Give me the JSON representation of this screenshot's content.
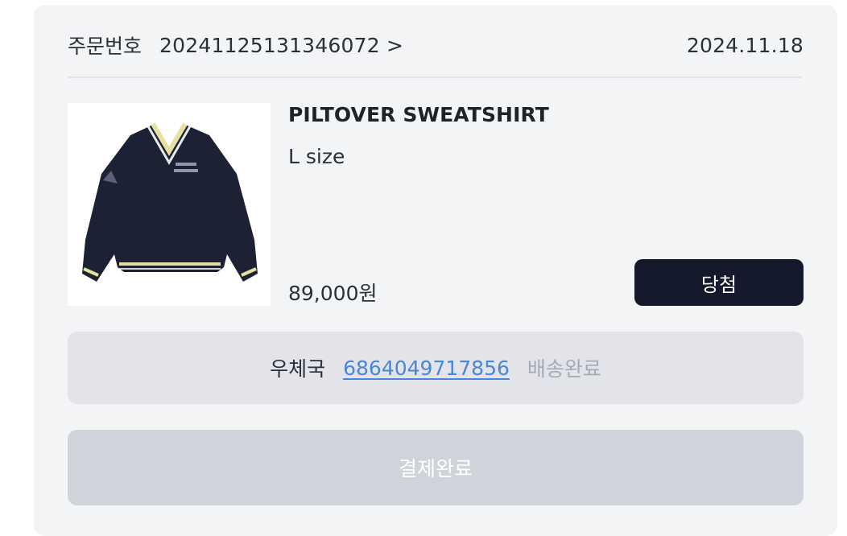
{
  "order": {
    "label": "주문번호",
    "number": "20241125131346072 >",
    "date": "2024.11.18"
  },
  "product": {
    "name": "PILTOVER SWEATSHIRT",
    "option": "L size",
    "price": "89,000원",
    "image_icon": "navy-v-neck-sweatshirt-image",
    "status_label": "당첨"
  },
  "shipping": {
    "carrier": "우체국",
    "tracking_number": "6864049717856",
    "status": "배송완료"
  },
  "payment": {
    "label": "결제완료"
  },
  "colors": {
    "background": "#f3f4f6",
    "primary_button": "#141a2b",
    "tracking_link": "#4a86d6",
    "disabled_button": "#d1d3da"
  }
}
